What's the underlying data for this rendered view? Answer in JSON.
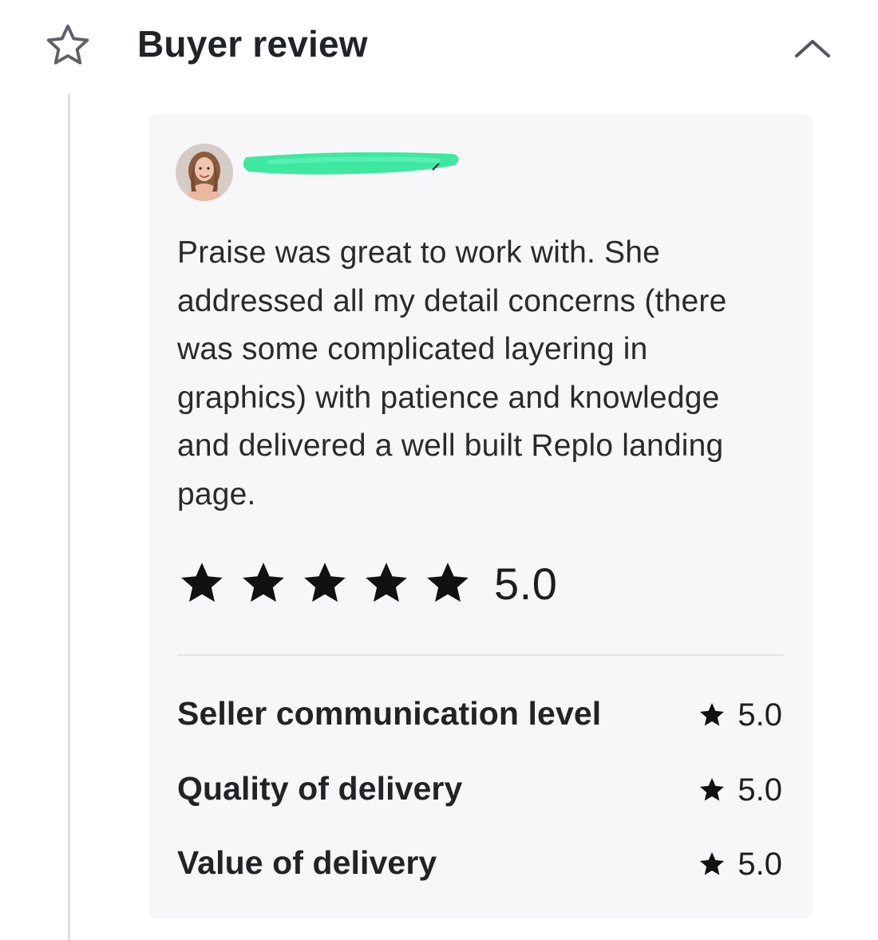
{
  "header": {
    "title": "Buyer review",
    "star_icon": "star-outline-icon",
    "collapse_icon": "chevron-up-icon"
  },
  "review": {
    "avatar_icon": "reviewer-avatar",
    "reviewer_name_redacted": true,
    "redaction_color": "#3ee8a0",
    "text": "Praise was great to work with. She addressed all my detail concerns (there was some complicated layering in graphics) with patience and knowledge and delivered a well built Replo landing page.",
    "rating": {
      "stars": 5,
      "value": "5.0"
    },
    "details": [
      {
        "label": "Seller communication level",
        "value": "5.0"
      },
      {
        "label": "Quality of delivery",
        "value": "5.0"
      },
      {
        "label": "Value of delivery",
        "value": "5.0"
      }
    ]
  },
  "colors": {
    "card_background": "#f7f6f9",
    "star_fill": "#111111",
    "timeline": "#dedde2"
  }
}
